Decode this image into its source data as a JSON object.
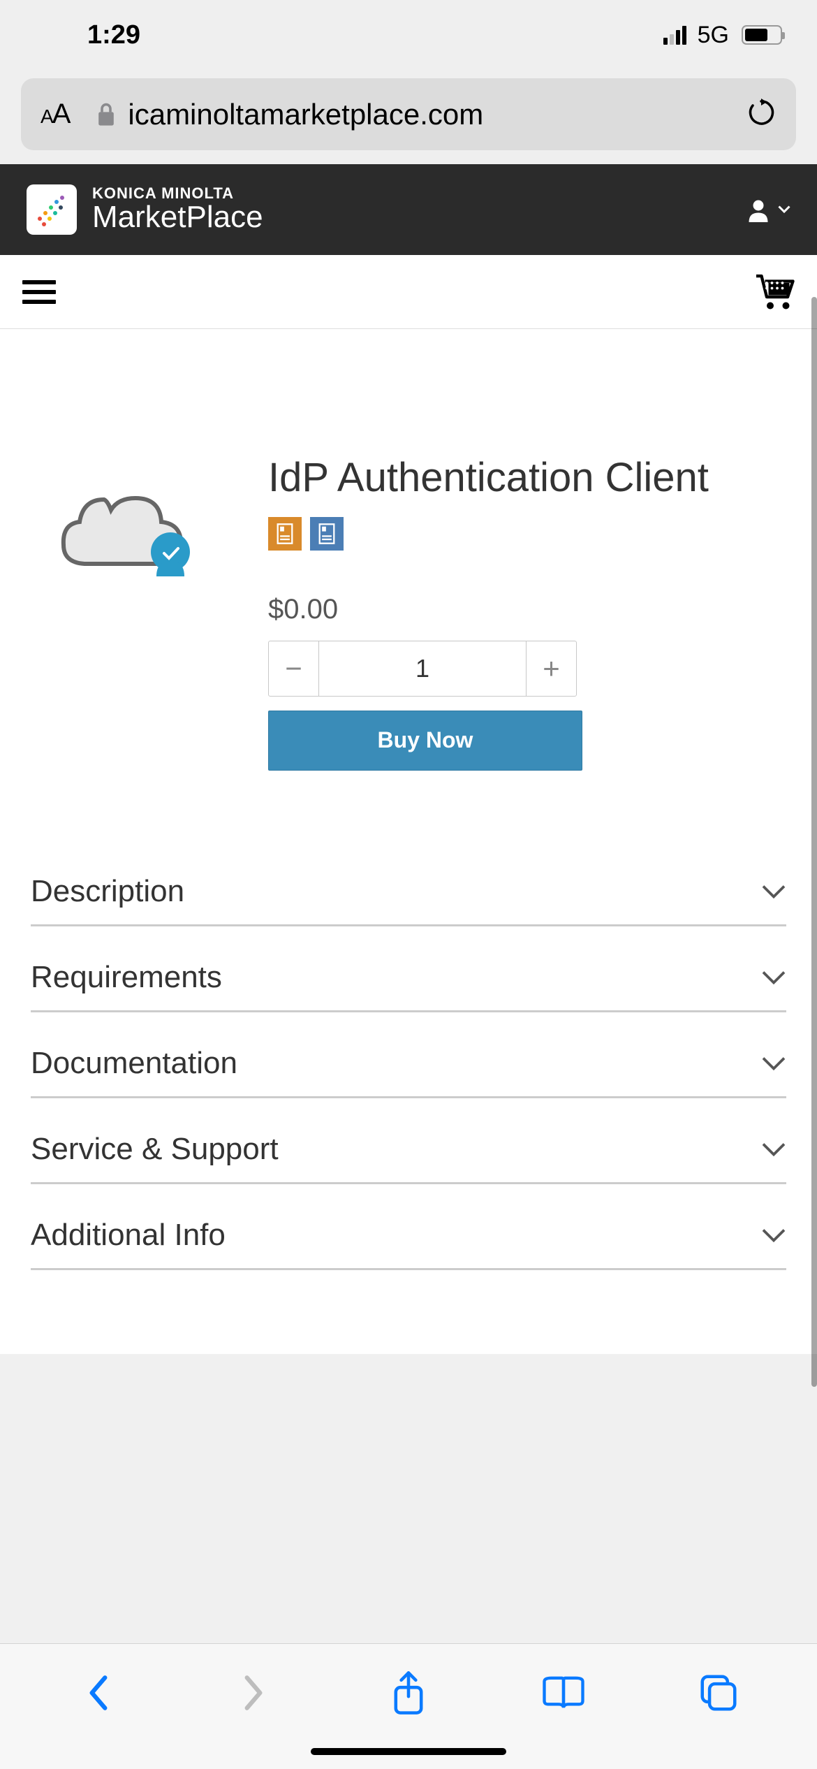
{
  "status": {
    "time": "1:29",
    "network": "5G"
  },
  "address_bar": {
    "url_display": "icaminoltamarketplace.com"
  },
  "site_header": {
    "brand_line1": "KONICA MINOLTA",
    "brand_line2": "MarketPlace"
  },
  "product": {
    "title": "IdP Authentication Client",
    "price": "$0.00",
    "quantity": "1",
    "buy_label": "Buy Now"
  },
  "accordion": [
    {
      "label": "Description"
    },
    {
      "label": "Requirements"
    },
    {
      "label": "Documentation"
    },
    {
      "label": "Service & Support"
    },
    {
      "label": "Additional Info"
    }
  ]
}
